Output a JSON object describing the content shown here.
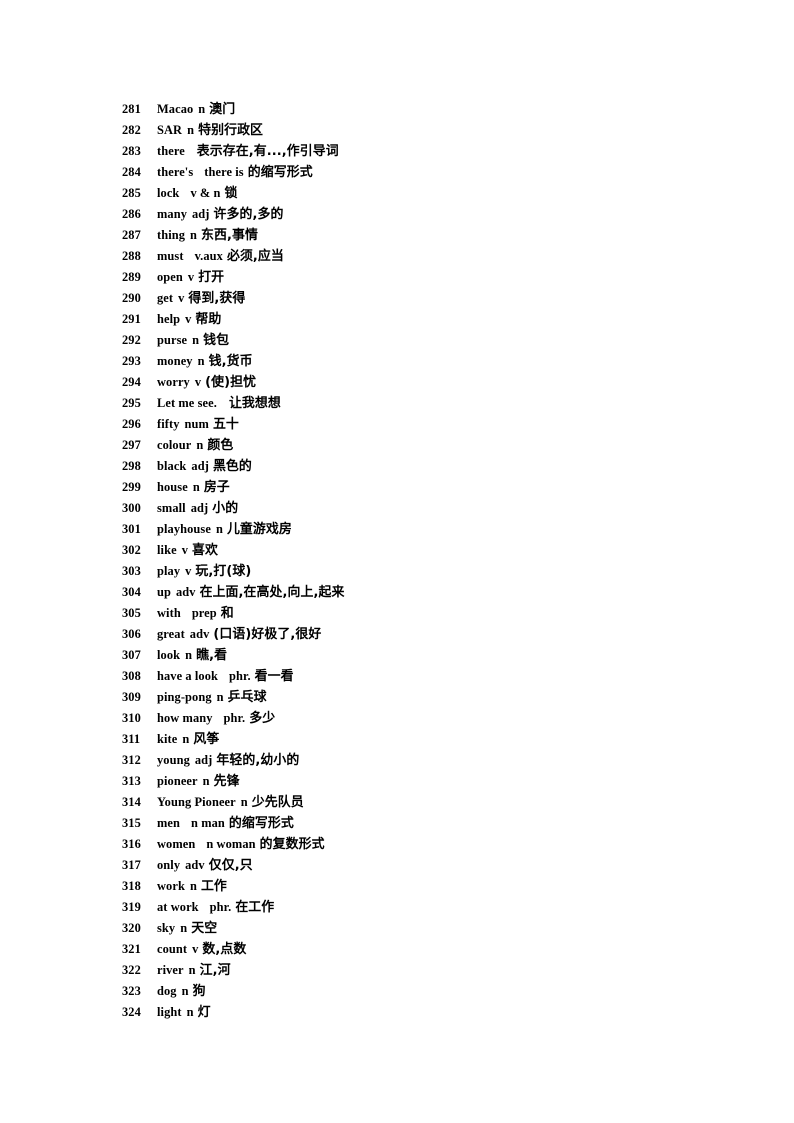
{
  "document": {
    "type": "vocabulary-list",
    "page_background": "#ffffff",
    "text_color": "#000000",
    "first_entry_number": 281,
    "last_entry_number": 324,
    "entry_count": 44,
    "entries": [
      {
        "num": "281",
        "word": "Macao",
        "pos": "n",
        "def": "澳门"
      },
      {
        "num": "282",
        "word": "SAR",
        "pos": "n",
        "def": "特别行政区"
      },
      {
        "num": "283",
        "word": "there",
        "pos": "",
        "def": "表示存在,有...,作引导词"
      },
      {
        "num": "284",
        "word": "there's",
        "pos": "there is",
        "def": "的缩写形式"
      },
      {
        "num": "285",
        "word": "lock",
        "pos": "v & n",
        "def": "锁"
      },
      {
        "num": "286",
        "word": "many",
        "pos": "adj",
        "def": "许多的,多的"
      },
      {
        "num": "287",
        "word": "thing",
        "pos": "n",
        "def": "东西,事情"
      },
      {
        "num": "288",
        "word": "must",
        "pos": "v.aux",
        "def": "必须,应当"
      },
      {
        "num": "289",
        "word": "open",
        "pos": "v",
        "def": "打开"
      },
      {
        "num": "290",
        "word": "get",
        "pos": "v",
        "def": "得到,获得"
      },
      {
        "num": "291",
        "word": "help",
        "pos": "v",
        "def": "帮助"
      },
      {
        "num": "292",
        "word": "purse",
        "pos": "n",
        "def": "钱包"
      },
      {
        "num": "293",
        "word": "money",
        "pos": "n",
        "def": "钱,货币"
      },
      {
        "num": "294",
        "word": "worry",
        "pos": "v",
        "def": "(使)担忧"
      },
      {
        "num": "295",
        "word": "Let me see.",
        "pos": "",
        "def": "让我想想"
      },
      {
        "num": "296",
        "word": "fifty",
        "pos": "num",
        "def": "五十"
      },
      {
        "num": "297",
        "word": "colour",
        "pos": "n",
        "def": "颜色"
      },
      {
        "num": "298",
        "word": "black",
        "pos": "adj",
        "def": "黑色的"
      },
      {
        "num": "299",
        "word": "house",
        "pos": "n",
        "def": "房子"
      },
      {
        "num": "300",
        "word": "small",
        "pos": "adj",
        "def": "小的"
      },
      {
        "num": "301",
        "word": "playhouse",
        "pos": "n",
        "def": "儿童游戏房"
      },
      {
        "num": "302",
        "word": "like",
        "pos": "v",
        "def": "喜欢"
      },
      {
        "num": "303",
        "word": "play",
        "pos": "v",
        "def": "玩,打(球)"
      },
      {
        "num": "304",
        "word": "up",
        "pos": "adv",
        "def": "在上面,在高处,向上,起来"
      },
      {
        "num": "305",
        "word": "with",
        "pos": "prep",
        "def": "和"
      },
      {
        "num": "306",
        "word": "great",
        "pos": "adv",
        "def": "(口语)好极了,很好"
      },
      {
        "num": "307",
        "word": "look",
        "pos": "n",
        "def": "瞧,看"
      },
      {
        "num": "308",
        "word": "have a look",
        "pos": "phr.",
        "def": "看一看"
      },
      {
        "num": "309",
        "word": "ping-pong",
        "pos": "n",
        "def": "乒乓球"
      },
      {
        "num": "310",
        "word": "how many",
        "pos": "phr.",
        "def": "多少"
      },
      {
        "num": "311",
        "word": "kite",
        "pos": "n",
        "def": "风筝"
      },
      {
        "num": "312",
        "word": "young",
        "pos": "adj",
        "def": "年轻的,幼小的"
      },
      {
        "num": "313",
        "word": "pioneer",
        "pos": "n",
        "def": "先锋"
      },
      {
        "num": "314",
        "word": "Young Pioneer",
        "pos": "n",
        "def": "少先队员"
      },
      {
        "num": "315",
        "word": "men",
        "pos": "n man",
        "def": "的缩写形式"
      },
      {
        "num": "316",
        "word": "women",
        "pos": "n woman",
        "def": "的复数形式"
      },
      {
        "num": "317",
        "word": "only",
        "pos": "adv",
        "def": "仅仅,只"
      },
      {
        "num": "318",
        "word": "work",
        "pos": "n",
        "def": "工作"
      },
      {
        "num": "319",
        "word": "at work",
        "pos": "phr.",
        "def": "在工作"
      },
      {
        "num": "320",
        "word": "sky",
        "pos": "n",
        "def": "天空"
      },
      {
        "num": "321",
        "word": "count",
        "pos": "v",
        "def": "数,点数"
      },
      {
        "num": "322",
        "word": "river",
        "pos": "n",
        "def": "江,河"
      },
      {
        "num": "323",
        "word": "dog",
        "pos": "n",
        "def": "狗"
      },
      {
        "num": "324",
        "word": "light",
        "pos": "n",
        "def": "灯"
      }
    ]
  }
}
